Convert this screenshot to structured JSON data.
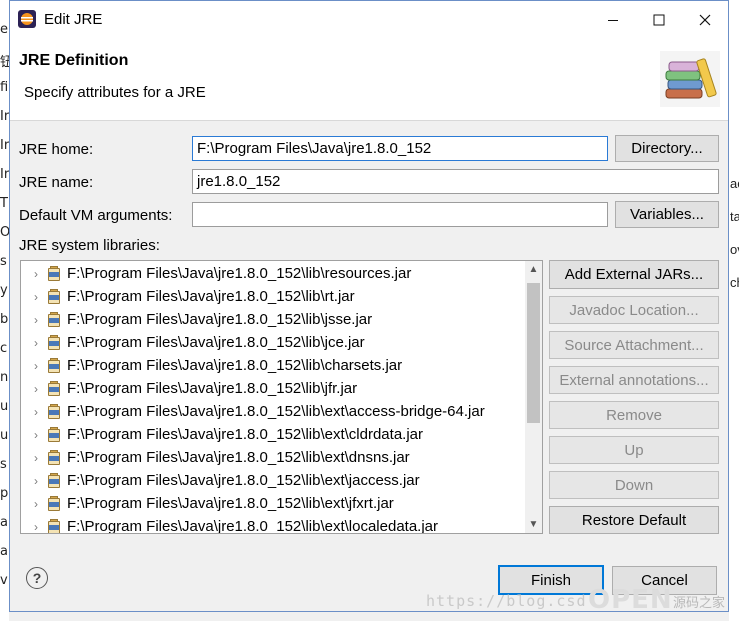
{
  "window": {
    "title": "Edit JRE"
  },
  "header": {
    "title": "JRE Definition",
    "subtitle": "Specify attributes for a JRE"
  },
  "form": {
    "jre_home_label": "JRE home:",
    "jre_home_value": "F:\\Program Files\\Java\\jre1.8.0_152",
    "directory_button": "Directory...",
    "jre_name_label": "JRE name:",
    "jre_name_value": "jre1.8.0_152",
    "vm_args_label": "Default VM arguments:",
    "vm_args_value": "",
    "variables_button": "Variables...",
    "libraries_label": "JRE system libraries:"
  },
  "libraries": [
    "F:\\Program Files\\Java\\jre1.8.0_152\\lib\\resources.jar",
    "F:\\Program Files\\Java\\jre1.8.0_152\\lib\\rt.jar",
    "F:\\Program Files\\Java\\jre1.8.0_152\\lib\\jsse.jar",
    "F:\\Program Files\\Java\\jre1.8.0_152\\lib\\jce.jar",
    "F:\\Program Files\\Java\\jre1.8.0_152\\lib\\charsets.jar",
    "F:\\Program Files\\Java\\jre1.8.0_152\\lib\\jfr.jar",
    "F:\\Program Files\\Java\\jre1.8.0_152\\lib\\ext\\access-bridge-64.jar",
    "F:\\Program Files\\Java\\jre1.8.0_152\\lib\\ext\\cldrdata.jar",
    "F:\\Program Files\\Java\\jre1.8.0_152\\lib\\ext\\dnsns.jar",
    "F:\\Program Files\\Java\\jre1.8.0_152\\lib\\ext\\jaccess.jar",
    "F:\\Program Files\\Java\\jre1.8.0_152\\lib\\ext\\jfxrt.jar",
    "F:\\Program Files\\Java\\jre1.8.0_152\\lib\\ext\\localedata.jar"
  ],
  "side_buttons": {
    "add_external_jars": "Add External JARs...",
    "javadoc_location": "Javadoc Location...",
    "source_attachment": "Source Attachment...",
    "external_annotations": "External annotations...",
    "remove": "Remove",
    "up": "Up",
    "down": "Down",
    "restore_default": "Restore Default"
  },
  "footer": {
    "finish": "Finish",
    "cancel": "Cancel",
    "help_glyph": "?"
  },
  "watermark": {
    "url_text": "https://blog.csd",
    "logo_text": "OPEN",
    "logo_sub": "源码之家"
  },
  "background_chars": {
    "left": [
      "e",
      "钮",
      "fi",
      "Ir",
      "Ir",
      "Ir",
      "T",
      "O",
      "s",
      "y",
      "b",
      "c",
      "n",
      "ug",
      "ui",
      "s",
      "pr",
      "ar",
      "a",
      "v"
    ],
    "right": [
      "ac",
      "ta",
      "ov",
      "ch"
    ]
  },
  "icons": {
    "app": "eclipse-icon",
    "minimize": "minimize-icon",
    "maximize": "maximize-icon",
    "close": "close-icon",
    "header_art": "books-icon",
    "jar": "jar-icon",
    "help": "help-icon"
  },
  "colors": {
    "accent": "#0078d7",
    "focus_border": "#2a7ad5"
  }
}
